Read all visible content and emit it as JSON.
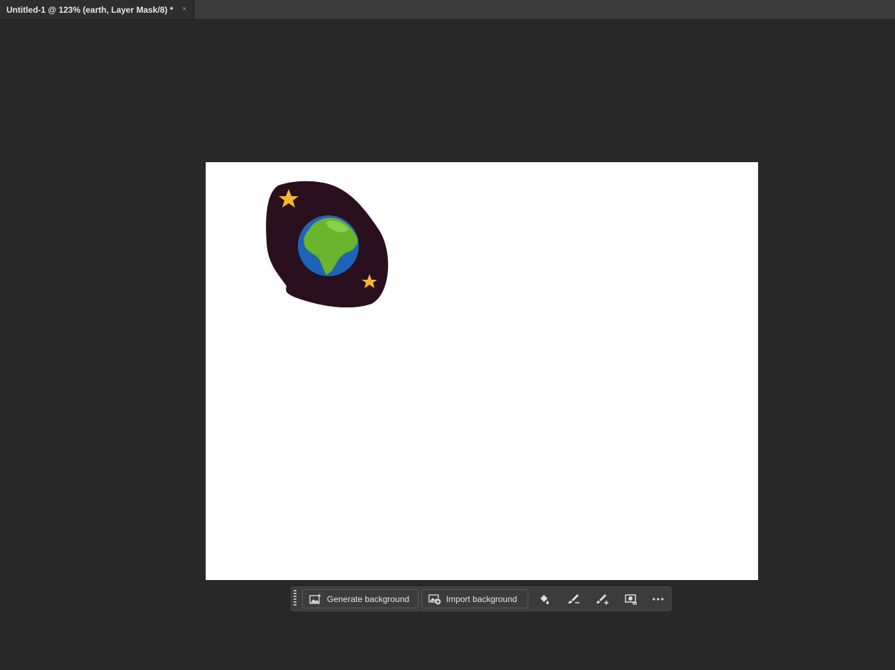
{
  "tab": {
    "title": "Untitled-1 @ 123% (earth, Layer Mask/8) *",
    "close_glyph": "×"
  },
  "canvas": {
    "background": "#ffffff",
    "artwork": "earth-with-stars",
    "artwork_colors": {
      "space": "#2a0f1f",
      "ocean": "#1f63b8",
      "land": "#6ab42e",
      "star": "#f5b82e"
    }
  },
  "taskbar": {
    "generate_background_label": "Generate background",
    "import_background_label": "Import background",
    "icons": [
      "fill-mask-icon",
      "subtract-brush-icon",
      "add-brush-icon",
      "mask-settings-icon",
      "more-options-icon"
    ]
  },
  "colors": {
    "app_background": "#282828",
    "tabbar": "#3b3b3b",
    "taskbar": "#3c3c3c"
  }
}
